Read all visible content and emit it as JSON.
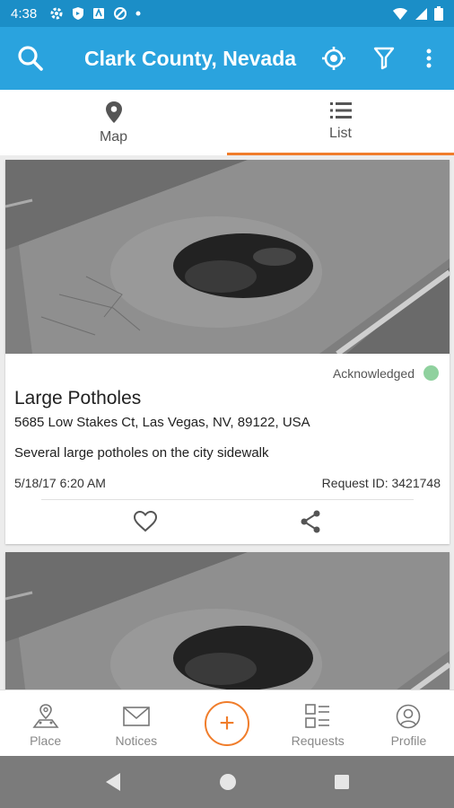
{
  "status_bar": {
    "time": "4:38"
  },
  "app_bar": {
    "title": "Clark County, Nevada"
  },
  "tabs": [
    {
      "label": "Map",
      "icon": "map-pin-icon",
      "active": false
    },
    {
      "label": "List",
      "icon": "list-icon",
      "active": true
    }
  ],
  "reports": [
    {
      "status": "Acknowledged",
      "status_color": "#8fd19e",
      "title": "Large Potholes",
      "address": "5685 Low Stakes Ct, Las Vegas, NV, 89122, USA",
      "description": "Several large potholes on the city sidewalk",
      "date": "5/18/17 6:20 AM",
      "request_id": "Request ID: 3421748"
    }
  ],
  "bottom_nav": {
    "items": [
      {
        "label": "Place",
        "icon": "place-icon"
      },
      {
        "label": "Notices",
        "icon": "mail-icon"
      },
      {
        "label": "Requests",
        "icon": "requests-icon"
      },
      {
        "label": "Profile",
        "icon": "profile-icon"
      }
    ],
    "fab_label": "+"
  },
  "colors": {
    "accent": "#f07d2b",
    "app_bar": "#2aa3de",
    "status_bar": "#1b8ec7"
  }
}
